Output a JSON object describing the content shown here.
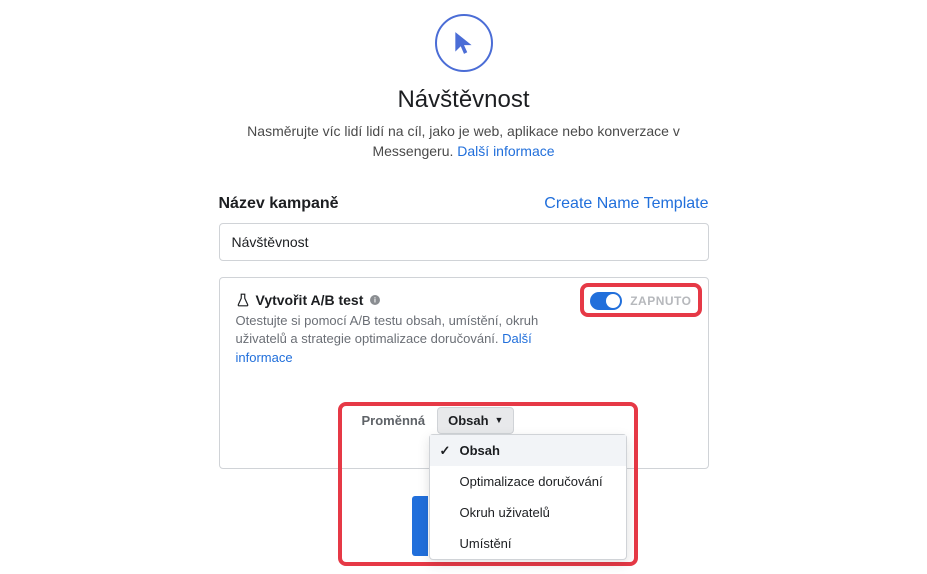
{
  "header": {
    "title": "Návštěvnost",
    "subtitle_pre": "Nasměrujte víc lidí lidí na cíl, jako je web, aplikace nebo konverzace v Messengeru. ",
    "subtitle_link": "Další informace"
  },
  "campaign": {
    "section_label": "Název kampaně",
    "template_link": "Create Name Template",
    "name_value": "Návštěvnost"
  },
  "abtest": {
    "title": "Vytvořit A/B test",
    "description_pre": "Otestujte si pomocí A/B testu obsah, umístění, okruh uživatelů a strategie optimalizace doručování. ",
    "description_link": "Další informace",
    "toggle_state": "ZAPNUTO",
    "variable_label": "Proměnná",
    "selected_value": "Obsah",
    "options": [
      "Obsah",
      "Optimalizace doručování",
      "Okruh uživatelů",
      "Umístění"
    ]
  }
}
